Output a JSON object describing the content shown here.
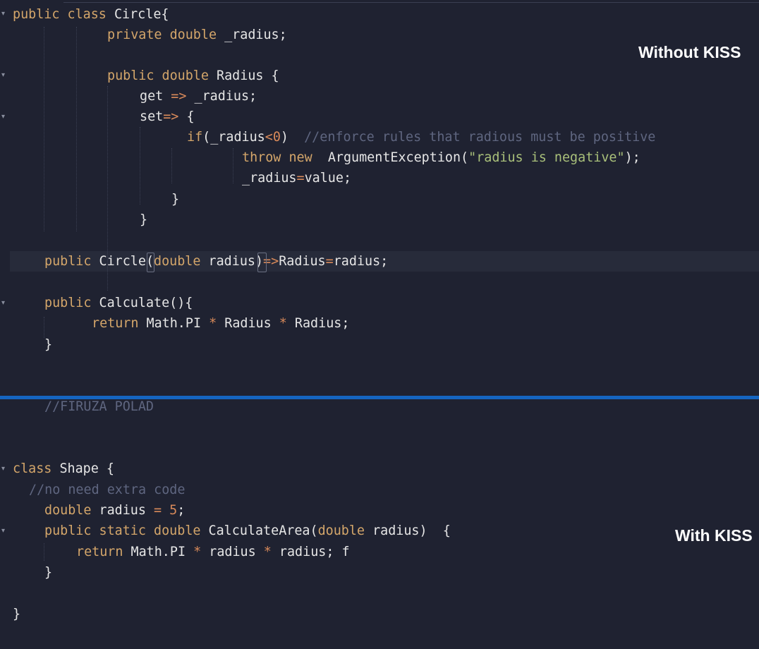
{
  "labels": {
    "without": "Without KISS",
    "with": "With KISS"
  },
  "code_top": [
    {
      "parts": [
        [
          "kw",
          "public"
        ],
        [
          "pl",
          " "
        ],
        [
          "kw",
          "class"
        ],
        [
          "pl",
          " Circle{"
        ]
      ]
    },
    {
      "parts": [
        [
          "kw",
          "private"
        ],
        [
          "pl",
          " "
        ],
        [
          "ty",
          "double"
        ],
        [
          "pl",
          " _radius;"
        ]
      ]
    },
    {
      "parts": []
    },
    {
      "parts": [
        [
          "kw",
          "public"
        ],
        [
          "pl",
          " "
        ],
        [
          "ty",
          "double"
        ],
        [
          "pl",
          " Radius {"
        ]
      ]
    },
    {
      "parts": [
        [
          "pl",
          "get "
        ],
        [
          "op",
          "=>"
        ],
        [
          "pl",
          " _radius;"
        ]
      ]
    },
    {
      "parts": [
        [
          "pl",
          "set"
        ],
        [
          "op",
          "=>"
        ],
        [
          "pl",
          " {"
        ]
      ]
    },
    {
      "parts": [
        [
          "kw",
          "if"
        ],
        [
          "pl",
          "(_radius"
        ],
        [
          "op",
          "<"
        ],
        [
          "num",
          "0"
        ],
        [
          "pl",
          ")  "
        ],
        [
          "cm",
          "//enforce rules that radious must be positive"
        ]
      ]
    },
    {
      "parts": [
        [
          "kw",
          "throw"
        ],
        [
          "pl",
          " "
        ],
        [
          "kw",
          "new"
        ],
        [
          "pl",
          "  ArgumentException("
        ],
        [
          "str",
          "\"radius is negative\""
        ],
        [
          "pl",
          ");"
        ]
      ]
    },
    {
      "parts": [
        [
          "pl",
          "_radius"
        ],
        [
          "op",
          "="
        ],
        [
          "pl",
          "value;"
        ]
      ]
    },
    {
      "parts": [
        [
          "pl",
          "}"
        ]
      ]
    },
    {
      "parts": [
        [
          "pl",
          "}"
        ]
      ]
    },
    {
      "parts": []
    },
    {
      "parts": [
        [
          "kw",
          "public"
        ],
        [
          "pl",
          " Circle("
        ],
        [
          "ty",
          "double"
        ],
        [
          "pl",
          " radius)"
        ],
        [
          "op",
          "=>"
        ],
        [
          "pl",
          "Radius"
        ],
        [
          "op",
          "="
        ],
        [
          "pl",
          "radius;"
        ]
      ]
    },
    {
      "parts": []
    },
    {
      "parts": [
        [
          "kw",
          "public"
        ],
        [
          "pl",
          " Calculate(){"
        ]
      ]
    },
    {
      "parts": [
        [
          "kw",
          "return"
        ],
        [
          "pl",
          " Math.PI "
        ],
        [
          "op",
          "*"
        ],
        [
          "pl",
          " Radius "
        ],
        [
          "op",
          "*"
        ],
        [
          "pl",
          " Radius;"
        ]
      ]
    },
    {
      "parts": [
        [
          "pl",
          "}"
        ]
      ]
    }
  ],
  "code_bottom": [
    {
      "parts": [
        [
          "cm",
          "//FIRUZA POLAD"
        ]
      ]
    },
    {
      "parts": []
    },
    {
      "parts": []
    },
    {
      "parts": [
        [
          "kw",
          "class"
        ],
        [
          "pl",
          " Shape {"
        ]
      ]
    },
    {
      "parts": [
        [
          "cm",
          "//no need extra code"
        ]
      ]
    },
    {
      "parts": [
        [
          "ty",
          "double"
        ],
        [
          "pl",
          " radius "
        ],
        [
          "op",
          "="
        ],
        [
          "pl",
          " "
        ],
        [
          "num",
          "5"
        ],
        [
          "pl",
          ";"
        ]
      ]
    },
    {
      "parts": [
        [
          "kw",
          "public"
        ],
        [
          "pl",
          " "
        ],
        [
          "kw",
          "static"
        ],
        [
          "pl",
          " "
        ],
        [
          "ty",
          "double"
        ],
        [
          "pl",
          " CalculateArea("
        ],
        [
          "ty",
          "double"
        ],
        [
          "pl",
          " radius)  {"
        ]
      ]
    },
    {
      "parts": [
        [
          "kw",
          "return"
        ],
        [
          "pl",
          " Math.PI "
        ],
        [
          "op",
          "*"
        ],
        [
          "pl",
          " radius "
        ],
        [
          "op",
          "*"
        ],
        [
          "pl",
          " radius; f"
        ]
      ]
    },
    {
      "parts": [
        [
          "pl",
          "}"
        ]
      ]
    },
    {
      "parts": []
    },
    {
      "parts": [
        [
          "pl",
          "}"
        ]
      ]
    }
  ]
}
